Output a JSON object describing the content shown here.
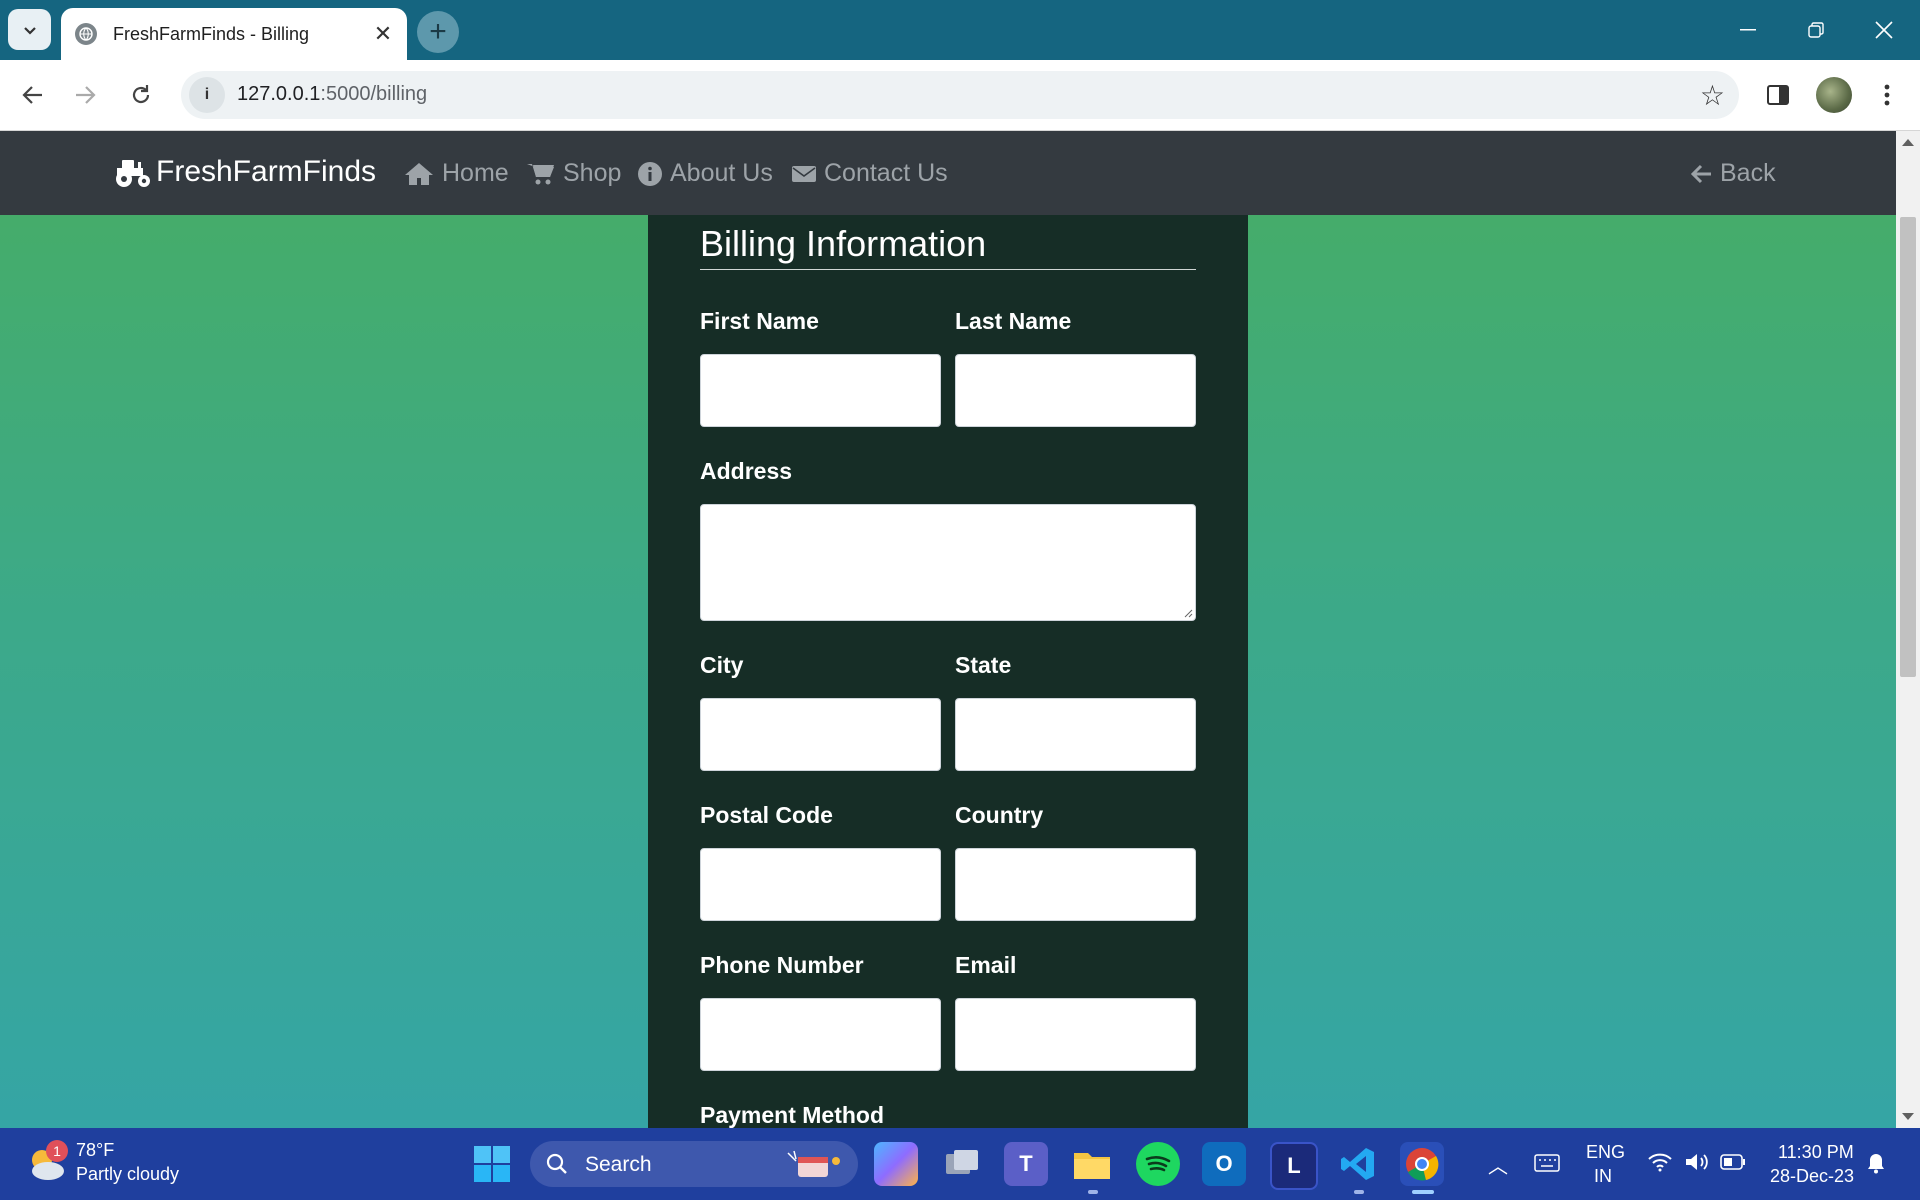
{
  "browser": {
    "tab_title": "FreshFarmFinds - Billing",
    "url_host": "127.0.0.1",
    "url_path": ":5000/billing"
  },
  "site": {
    "brand": "FreshFarmFinds",
    "nav": [
      {
        "label": "Home",
        "icon": "home-icon"
      },
      {
        "label": "Shop",
        "icon": "cart-icon"
      },
      {
        "label": "About Us",
        "icon": "info-icon"
      },
      {
        "label": "Contact Us",
        "icon": "envelope-icon"
      }
    ],
    "back_label": "Back"
  },
  "form": {
    "heading": "Billing Information",
    "first_name": "First Name",
    "last_name": "Last Name",
    "address": "Address",
    "city": "City",
    "state": "State",
    "postal_code": "Postal Code",
    "country": "Country",
    "phone": "Phone Number",
    "email": "Email",
    "payment": "Payment Method"
  },
  "taskbar": {
    "weather_temp": "78°F",
    "weather_desc": "Partly cloudy",
    "weather_badge": "1",
    "search_label": "Search",
    "lang_top": "ENG",
    "lang_bottom": "IN",
    "time": "11:30 PM",
    "date": "28-Dec-23"
  },
  "colors": {
    "navbar": "#343a40",
    "panel": "#162d26",
    "bg_top": "#47ad64",
    "bg_bottom": "#35a5a5",
    "taskbar": "#1f3f9e",
    "tabstrip": "#156580"
  }
}
